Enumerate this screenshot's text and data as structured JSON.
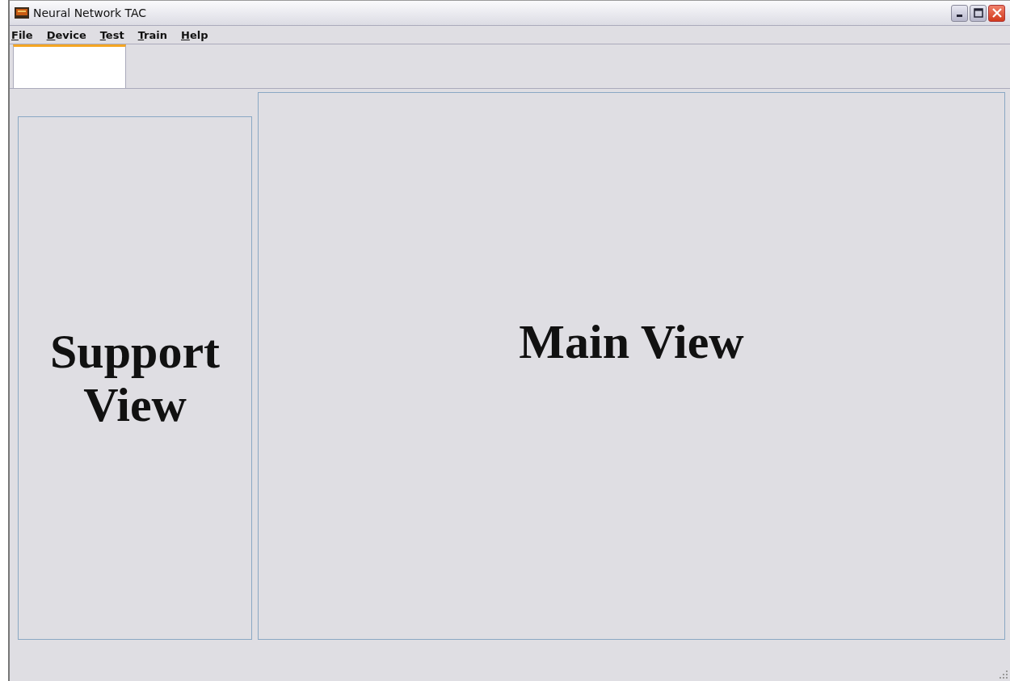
{
  "window": {
    "title": "Neural Network TAC"
  },
  "menu": [
    "File",
    "Device",
    "Test",
    "Train",
    "Help"
  ],
  "tabs": [
    {
      "selected": true
    }
  ],
  "support_view": {
    "label": "Support View"
  },
  "main_view": {
    "label": "Main View"
  }
}
